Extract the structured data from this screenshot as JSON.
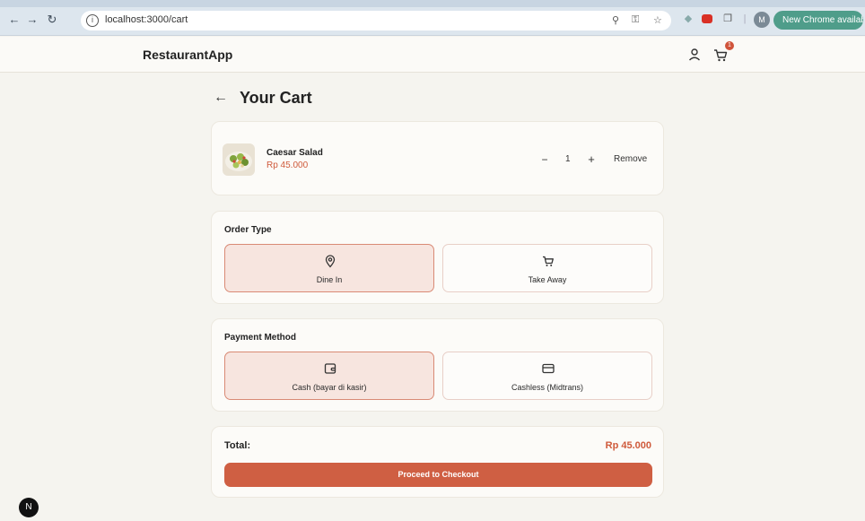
{
  "browser": {
    "url": "localhost:3000/cart",
    "update_button": "New Chrome available",
    "profile_initial": "M",
    "icons": [
      "back-icon",
      "forward-icon",
      "reload-icon",
      "site-info-icon",
      "zoom-icon",
      "password-key-icon",
      "bookmark-star-icon",
      "extension-icon",
      "extensions-puzzle-icon",
      "profile-avatar",
      "menu-kebab-icon"
    ]
  },
  "header": {
    "brand": "RestaurantApp",
    "cart_badge": "1"
  },
  "page": {
    "title": "Your Cart"
  },
  "cart": {
    "items": [
      {
        "name": "Caesar Salad",
        "price": "Rp 45.000",
        "quantity": "1",
        "remove_label": "Remove",
        "minus_label": "−",
        "plus_label": "+"
      }
    ]
  },
  "order_type": {
    "title": "Order Type",
    "options": [
      {
        "label": "Dine In",
        "icon": "map-pin-icon",
        "selected": true
      },
      {
        "label": "Take Away",
        "icon": "cart-icon",
        "selected": false
      }
    ]
  },
  "payment": {
    "title": "Payment Method",
    "options": [
      {
        "label": "Cash (bayar di kasir)",
        "icon": "wallet-icon",
        "selected": true
      },
      {
        "label": "Cashless (Midtrans)",
        "icon": "credit-card-icon",
        "selected": false
      }
    ]
  },
  "summary": {
    "total_label": "Total:",
    "total_value": "Rp 45.000",
    "checkout_label": "Proceed to Checkout"
  },
  "dev_indicator": "N",
  "colors": {
    "accent": "#cf5f43",
    "price": "#cf5a3b",
    "selected_bg": "#f7e5df",
    "page_bg": "#f5f4ef"
  }
}
